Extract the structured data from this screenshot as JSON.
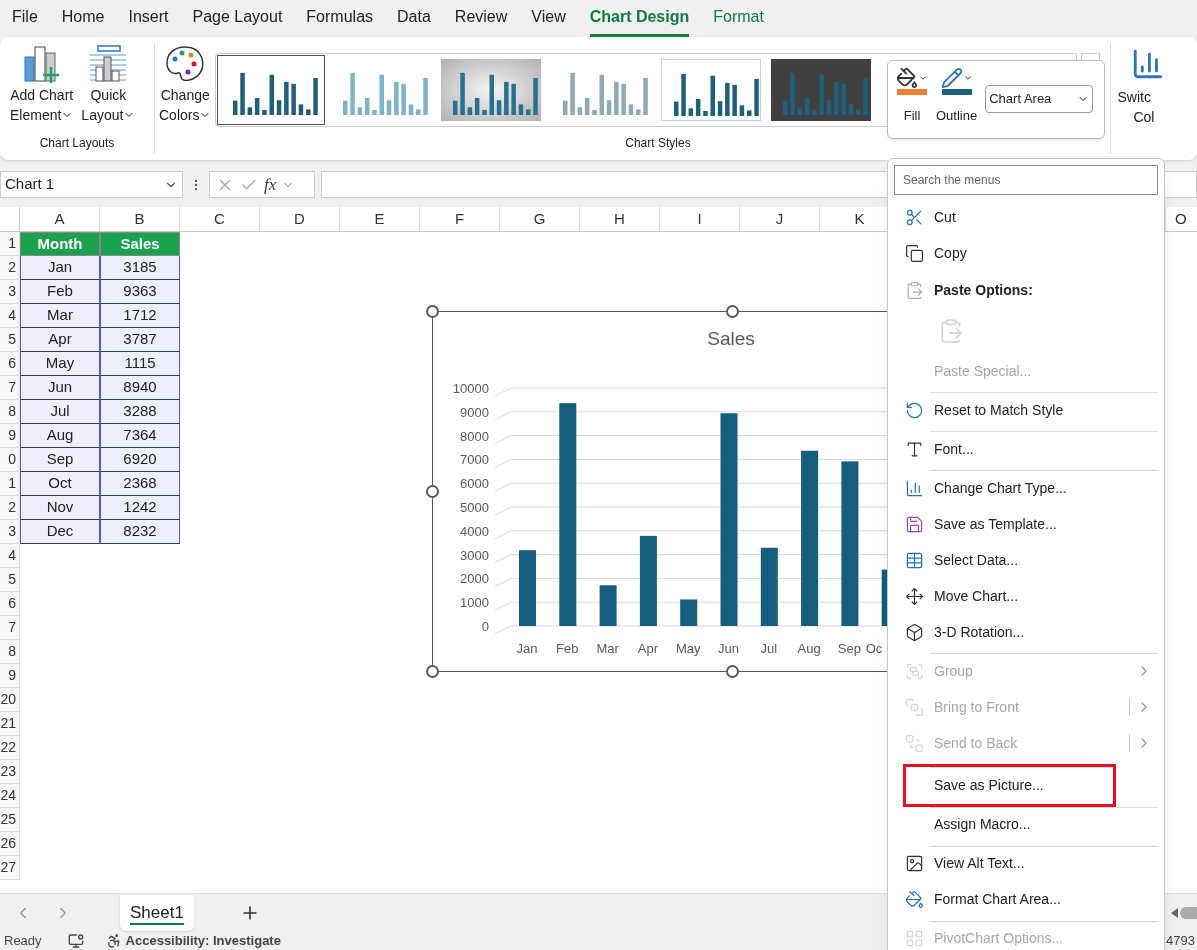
{
  "ribbon_tabs": [
    {
      "label": "File",
      "kind": "normal",
      "selected": false
    },
    {
      "label": "Home",
      "kind": "normal",
      "selected": false
    },
    {
      "label": "Insert",
      "kind": "normal",
      "selected": false
    },
    {
      "label": "Page Layout",
      "kind": "normal",
      "selected": false
    },
    {
      "label": "Formulas",
      "kind": "normal",
      "selected": false
    },
    {
      "label": "Data",
      "kind": "normal",
      "selected": false
    },
    {
      "label": "Review",
      "kind": "normal",
      "selected": false
    },
    {
      "label": "View",
      "kind": "normal",
      "selected": false
    },
    {
      "label": "Chart Design",
      "kind": "contextual",
      "selected": true
    },
    {
      "label": "Format",
      "kind": "contextual",
      "selected": false
    }
  ],
  "chart_layouts": {
    "label": "Chart Layouts",
    "buttons": [
      {
        "lines": [
          "Add Chart",
          "Element"
        ]
      },
      {
        "lines": [
          "Quick",
          "Layout"
        ]
      }
    ]
  },
  "change_colors": {
    "lines": [
      "Change",
      "Colors"
    ]
  },
  "chart_styles": {
    "label": "Chart Styles",
    "styles": [
      {
        "kind": "plain",
        "selected": true
      },
      {
        "kind": "pattern",
        "selected": false
      },
      {
        "kind": "gradient",
        "selected": false
      },
      {
        "kind": "faded",
        "selected": false
      },
      {
        "kind": "outlined",
        "selected": false
      },
      {
        "kind": "dark",
        "selected": false
      }
    ]
  },
  "switch_button": {
    "lines": [
      "Switc",
      "Col"
    ]
  },
  "mini_toolbar": {
    "fill": "Fill",
    "outline": "Outline",
    "element_select": "Chart Area"
  },
  "formula_bar": {
    "name_box": "Chart 1",
    "function_label": "fx"
  },
  "sheet": {
    "columns": [
      "A",
      "B",
      "C",
      "D",
      "E",
      "F",
      "G",
      "H",
      "I",
      "J",
      "K"
    ],
    "columns_right": [
      "O"
    ],
    "row_numbers": [
      "1",
      "2",
      "3",
      "4",
      "5",
      "6",
      "7",
      "8",
      "9",
      "0",
      "1",
      "2",
      "3",
      "4",
      "5",
      "6",
      "7",
      "8",
      "9",
      "20",
      "21",
      "22",
      "23",
      "24",
      "25",
      "26",
      "27"
    ],
    "header": [
      "Month",
      "Sales"
    ],
    "rows": [
      [
        "Jan",
        "3185"
      ],
      [
        "Feb",
        "9363"
      ],
      [
        "Mar",
        "1712"
      ],
      [
        "Apr",
        "3787"
      ],
      [
        "May",
        "1115"
      ],
      [
        "Jun",
        "8940"
      ],
      [
        "Jul",
        "3288"
      ],
      [
        "Aug",
        "7364"
      ],
      [
        "Sep",
        "6920"
      ],
      [
        "Oct",
        "2368"
      ],
      [
        "Nov",
        "1242"
      ],
      [
        "Dec",
        "8232"
      ]
    ]
  },
  "chart": {
    "chart_data": {
      "type": "bar",
      "title": "Sales",
      "categories": [
        "Jan",
        "Feb",
        "Mar",
        "Apr",
        "May",
        "Jun",
        "Jul",
        "Aug",
        "Sep",
        "Oc"
      ],
      "series": [
        {
          "color": "#155e7d",
          "values": [
            3185,
            9363,
            1712,
            3787,
            1115,
            8940,
            3288,
            7364,
            6920,
            2368
          ]
        }
      ],
      "grid": true,
      "ylim": [
        0,
        10000
      ],
      "yticks": [
        0,
        1000,
        2000,
        3000,
        4000,
        5000,
        6000,
        7000,
        8000,
        9000,
        10000
      ]
    }
  },
  "context_menu": {
    "search_placeholder": "Search the menus",
    "items": [
      {
        "label": "Cut",
        "kind": "item",
        "disabled": false,
        "submenu": false,
        "split": false,
        "highlighted": false,
        "separator_before": false
      },
      {
        "label": "Copy",
        "kind": "item",
        "disabled": false,
        "submenu": false,
        "split": false,
        "highlighted": false,
        "separator_before": false
      },
      {
        "label": "Paste Options:",
        "kind": "header",
        "disabled": false,
        "submenu": false,
        "split": false,
        "highlighted": false,
        "separator_before": false
      },
      {
        "kind": "paste-icons",
        "disabled": true,
        "submenu": false,
        "split": false,
        "highlighted": false,
        "separator_before": false
      },
      {
        "label": "Paste Special...",
        "kind": "item",
        "disabled": true,
        "submenu": false,
        "split": false,
        "highlighted": false,
        "separator_before": false
      },
      {
        "label": "Reset to Match Style",
        "kind": "item",
        "disabled": false,
        "submenu": false,
        "split": false,
        "highlighted": false,
        "separator_before": true
      },
      {
        "label": "Font...",
        "kind": "item",
        "disabled": false,
        "submenu": false,
        "split": false,
        "highlighted": false,
        "separator_before": true
      },
      {
        "label": "Change Chart Type...",
        "kind": "item",
        "disabled": false,
        "submenu": false,
        "split": false,
        "highlighted": false,
        "separator_before": true
      },
      {
        "label": "Save as Template...",
        "kind": "item",
        "disabled": false,
        "submenu": false,
        "split": false,
        "highlighted": false,
        "separator_before": false
      },
      {
        "label": "Select Data...",
        "kind": "item",
        "disabled": false,
        "submenu": false,
        "split": false,
        "highlighted": false,
        "separator_before": false
      },
      {
        "label": "Move Chart...",
        "kind": "item",
        "disabled": false,
        "submenu": false,
        "split": false,
        "highlighted": false,
        "separator_before": false
      },
      {
        "label": "3-D Rotation...",
        "kind": "item",
        "disabled": false,
        "submenu": false,
        "split": false,
        "highlighted": false,
        "separator_before": false
      },
      {
        "label": "Group",
        "kind": "item",
        "disabled": true,
        "submenu": true,
        "split": false,
        "highlighted": false,
        "separator_before": true
      },
      {
        "label": "Bring to Front",
        "kind": "item",
        "disabled": true,
        "submenu": true,
        "split": true,
        "highlighted": false,
        "separator_before": false
      },
      {
        "label": "Send to Back",
        "kind": "item",
        "disabled": true,
        "submenu": true,
        "split": true,
        "highlighted": false,
        "separator_before": false
      },
      {
        "label": "Save as Picture...",
        "kind": "item",
        "disabled": false,
        "submenu": false,
        "split": false,
        "highlighted": true,
        "separator_before": true
      },
      {
        "label": "Assign Macro...",
        "kind": "item",
        "disabled": false,
        "submenu": false,
        "split": false,
        "highlighted": false,
        "separator_before": true
      },
      {
        "label": "View Alt Text...",
        "kind": "item",
        "disabled": false,
        "submenu": false,
        "split": false,
        "highlighted": false,
        "separator_before": true
      },
      {
        "label": "Format Chart Area...",
        "kind": "item",
        "disabled": false,
        "submenu": false,
        "split": false,
        "highlighted": false,
        "separator_before": false
      },
      {
        "label": "PivotChart Options...",
        "kind": "item",
        "disabled": true,
        "submenu": false,
        "split": false,
        "highlighted": false,
        "separator_before": true
      }
    ]
  },
  "sheet_tabs": [
    {
      "label": "Sheet1",
      "selected": true
    }
  ],
  "status_bar": {
    "mode": "Ready",
    "accessibility": "Accessibility: Investigate",
    "count": "4793"
  }
}
